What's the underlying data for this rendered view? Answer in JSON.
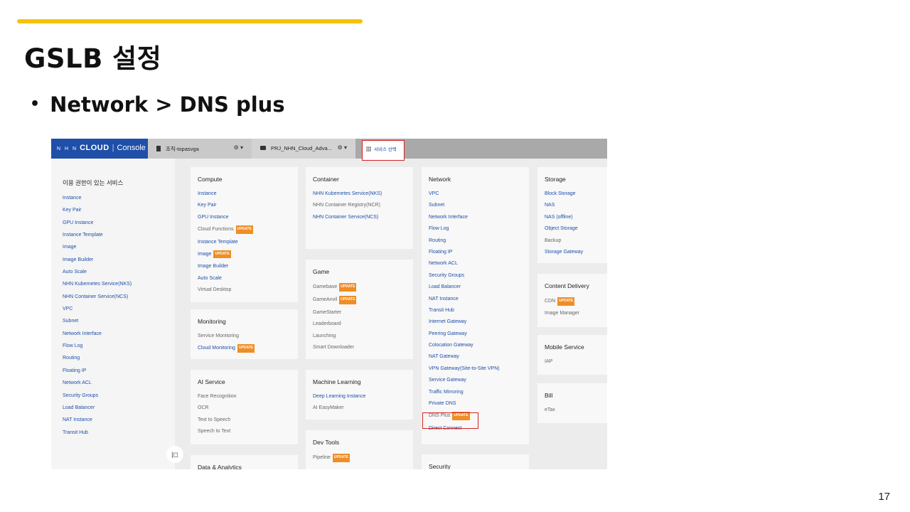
{
  "slide": {
    "title": "GSLB 설정",
    "bullet": "Network > DNS plus",
    "page_number": "17"
  },
  "colors": {
    "accent": "#f5c400",
    "brand": "#1f4fa8",
    "highlight": "#d62020",
    "badge": "#f08d24"
  },
  "console": {
    "logo": {
      "nhn": "N H N",
      "cloud": "CLOUD",
      "sep": "|",
      "console": "Console"
    },
    "org_label": "조직-topasvga",
    "project_label": "PRJ_NHN_Cloud_Adva...",
    "settings_glyph": "⚙ ▾",
    "service_select_label": "서비스 선택",
    "sidebar": {
      "heading": "이용 권한이 있는 서비스",
      "items": [
        "Instance",
        "Key Pair",
        "GPU Instance",
        "Instance Template",
        "Image",
        "Image Builder",
        "Auto Scale",
        "NHN Kubernetes Service(NKS)",
        "NHN Container Service(NCS)",
        "VPC",
        "Subnet",
        "Network Interface",
        "Flow Log",
        "Routing",
        "Floating IP",
        "Network ACL",
        "Security Groups",
        "Load Balancer",
        "NAT Instance",
        "Transit Hub"
      ],
      "collapse_glyph": "|◻"
    },
    "badge_text": "UPDATE",
    "cards": {
      "compute": {
        "title": "Compute",
        "items": [
          {
            "label": "Instance",
            "active": true
          },
          {
            "label": "Key Pair",
            "active": true
          },
          {
            "label": "GPU Instance",
            "active": true
          },
          {
            "label": "Cloud Functions",
            "active": false,
            "badge": true
          },
          {
            "label": "Instance Template",
            "active": true
          },
          {
            "label": "Image",
            "active": true,
            "badge": true
          },
          {
            "label": "Image Builder",
            "active": true
          },
          {
            "label": "Auto Scale",
            "active": true
          },
          {
            "label": "Virtual Desktop",
            "active": false
          }
        ]
      },
      "monitoring": {
        "title": "Monitoring",
        "items": [
          {
            "label": "Service Monitoring",
            "active": false
          },
          {
            "label": "Cloud Monitoring",
            "active": true,
            "badge": true
          }
        ]
      },
      "ai_service": {
        "title": "AI Service",
        "items": [
          {
            "label": "Face Recognition",
            "active": false
          },
          {
            "label": "OCR",
            "active": false
          },
          {
            "label": "Text to Speech",
            "active": false
          },
          {
            "label": "Speech to Text",
            "active": false
          }
        ]
      },
      "data_analytics": {
        "title": "Data & Analytics",
        "items": []
      },
      "container": {
        "title": "Container",
        "items": [
          {
            "label": "NHN Kubernetes Service(NKS)",
            "active": true
          },
          {
            "label": "NHN Container Registry(NCR)",
            "active": false
          },
          {
            "label": "NHN Container Service(NCS)",
            "active": true
          }
        ]
      },
      "game": {
        "title": "Game",
        "items": [
          {
            "label": "Gamebase",
            "active": false,
            "badge": true
          },
          {
            "label": "GameAnvil",
            "active": false,
            "badge": true
          },
          {
            "label": "GameStarter",
            "active": false
          },
          {
            "label": "Leaderboard",
            "active": false
          },
          {
            "label": "Launching",
            "active": false
          },
          {
            "label": "Smart Downloader",
            "active": false
          }
        ]
      },
      "machine_learning": {
        "title": "Machine Learning",
        "items": [
          {
            "label": "Deep Learning Instance",
            "active": true
          },
          {
            "label": "AI EasyMaker",
            "active": false
          }
        ]
      },
      "dev_tools": {
        "title": "Dev Tools",
        "items": [
          {
            "label": "Pipeline",
            "active": false,
            "badge": true
          }
        ]
      },
      "network": {
        "title": "Network",
        "items": [
          {
            "label": "VPC",
            "active": true
          },
          {
            "label": "Subnet",
            "active": true
          },
          {
            "label": "Network Interface",
            "active": true
          },
          {
            "label": "Flow Log",
            "active": true
          },
          {
            "label": "Routing",
            "active": true
          },
          {
            "label": "Floating IP",
            "active": true
          },
          {
            "label": "Network ACL",
            "active": true
          },
          {
            "label": "Security Groups",
            "active": true
          },
          {
            "label": "Load Balancer",
            "active": true
          },
          {
            "label": "NAT Instance",
            "active": true
          },
          {
            "label": "Transit Hub",
            "active": true
          },
          {
            "label": "Internet Gateway",
            "active": true
          },
          {
            "label": "Peering Gateway",
            "active": true
          },
          {
            "label": "Colocation Gateway",
            "active": true
          },
          {
            "label": "NAT Gateway",
            "active": true
          },
          {
            "label": "VPN Gateway(Site-to-Site VPN)",
            "active": true
          },
          {
            "label": "Service Gateway",
            "active": true
          },
          {
            "label": "Traffic Mirroring",
            "active": true
          },
          {
            "label": "Private DNS",
            "active": true
          },
          {
            "label": "DNS Plus",
            "active": false,
            "badge": true
          },
          {
            "label": "Direct Connect",
            "active": true
          }
        ]
      },
      "security": {
        "title": "Security",
        "items": []
      },
      "storage": {
        "title": "Storage",
        "items": [
          {
            "label": "Block Storage",
            "active": true
          },
          {
            "label": "NAS",
            "active": true
          },
          {
            "label": "NAS (offline)",
            "active": true
          },
          {
            "label": "Object Storage",
            "active": true
          },
          {
            "label": "Backup",
            "active": false
          },
          {
            "label": "Storage Gateway",
            "active": true
          }
        ]
      },
      "content_delivery": {
        "title": "Content Delivery",
        "items": [
          {
            "label": "CDN",
            "active": false,
            "badge": true
          },
          {
            "label": "Image Manager",
            "active": false
          }
        ]
      },
      "mobile_service": {
        "title": "Mobile Service",
        "items": [
          {
            "label": "IAP",
            "active": false
          }
        ]
      },
      "bill": {
        "title": "Bill",
        "items": [
          {
            "label": "eTax",
            "active": false
          }
        ]
      }
    }
  }
}
